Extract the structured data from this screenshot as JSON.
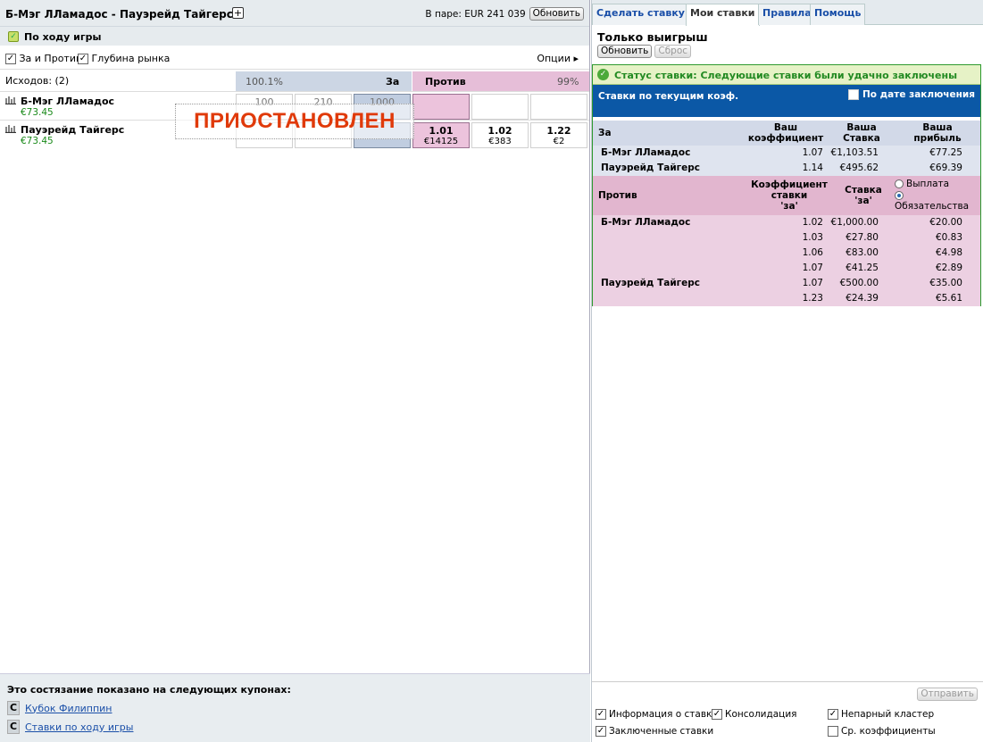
{
  "market": {
    "title": "Б-Мэг ЛЛамадос - Пауэрейд Тайгерс",
    "plus": "+",
    "matched_label": "В паре: EUR 241 039",
    "refresh_label": "Обновить",
    "inplay_label": "По ходу игры",
    "back_lay_label": "За и Против",
    "depth_label": "Глубина рынка",
    "options_label": "Опции",
    "options_arrow": "▸",
    "outcomes_label": "Исходов:  (2)",
    "back_pct": "100.1%",
    "back_label": "За",
    "lay_label": "Против",
    "lay_pct": "99%",
    "suspended_label": "ПРИОСТАНОВЛЕН",
    "runners": [
      {
        "name": "Б-Мэг ЛЛамадос",
        "position": "€73.45",
        "cells": [
          {
            "price": "100",
            "size": ""
          },
          {
            "price": "210",
            "size": ""
          },
          {
            "price": "1000",
            "size": ""
          },
          {
            "price": "",
            "size": ""
          },
          {
            "price": "",
            "size": ""
          },
          {
            "price": "",
            "size": ""
          }
        ]
      },
      {
        "name": "Пауэрейд Тайгерс",
        "position": "€73.45",
        "cells": [
          {
            "price": "",
            "size": ""
          },
          {
            "price": "",
            "size": ""
          },
          {
            "price": "",
            "size": ""
          },
          {
            "price": "1.01",
            "size": "€14125"
          },
          {
            "price": "1.02",
            "size": "€383"
          },
          {
            "price": "1.22",
            "size": "€2"
          }
        ]
      }
    ],
    "coupons_title": "Это состязание показано на следующих купонах:",
    "coupons": [
      {
        "badge": "C",
        "label": "Кубок Филиппин"
      },
      {
        "badge": "C",
        "label": "Ставки по ходу игры"
      }
    ]
  },
  "betslip": {
    "tabs": [
      "Сделать ставку",
      "Мои ставки",
      "Правила",
      "Помощь"
    ],
    "active_tab": 1,
    "subtitle": "Только выигрыш",
    "refresh_label": "Обновить",
    "reset_label": "Сброс",
    "status_text": "Статус ставки: Следующие ставки были удачно заключены",
    "current_odds_label": "Ставки по текущим коэф.",
    "by_date_label": "По дате заключения",
    "back_section": {
      "label": "За",
      "col_odds": [
        "Ваш",
        "коэффициент"
      ],
      "col_stake": [
        "Ваша",
        "Ставка"
      ],
      "col_profit": [
        "Ваша",
        "прибыль"
      ],
      "rows": [
        {
          "name": "Б-Мэг ЛЛамадос",
          "odds": "1.07",
          "stake": "€1,103.51",
          "profit": "€77.25"
        },
        {
          "name": "Пауэрейд Тайгерс",
          "odds": "1.14",
          "stake": "€495.62",
          "profit": "€69.39"
        }
      ]
    },
    "lay_section": {
      "label": "Против",
      "col_odds": [
        "Коэффициент",
        "ставки",
        "'за'"
      ],
      "col_stake": [
        "Ставка",
        "'за'"
      ],
      "radio_payout": "Выплата",
      "radio_liability": "Обязательства",
      "rows": [
        {
          "name": "Б-Мэг ЛЛамадос",
          "odds": "1.02",
          "stake": "€1,000.00",
          "liability": "€20.00"
        },
        {
          "name": "",
          "odds": "1.03",
          "stake": "€27.80",
          "liability": "€0.83"
        },
        {
          "name": "",
          "odds": "1.06",
          "stake": "€83.00",
          "liability": "€4.98"
        },
        {
          "name": "",
          "odds": "1.07",
          "stake": "€41.25",
          "liability": "€2.89"
        },
        {
          "name": "Пауэрейд Тайгерс",
          "odds": "1.07",
          "stake": "€500.00",
          "liability": "€35.00"
        },
        {
          "name": "",
          "odds": "1.23",
          "stake": "€24.39",
          "liability": "€5.61"
        }
      ]
    },
    "send_label": "Отправить",
    "footer_options": {
      "bet_info": "Информация о ставке",
      "consolidation": "Консолидация",
      "unpaired": "Непарный кластер",
      "matched_bets": "Заключенные ставки",
      "avg_odds": "Ср. коэффициенты"
    }
  },
  "colors": {
    "back": "#ccd6e4",
    "lay": "#e6bed8",
    "suspended": "#e03a0a",
    "status_green": "#228a22",
    "header_blue": "#0b58a6"
  }
}
